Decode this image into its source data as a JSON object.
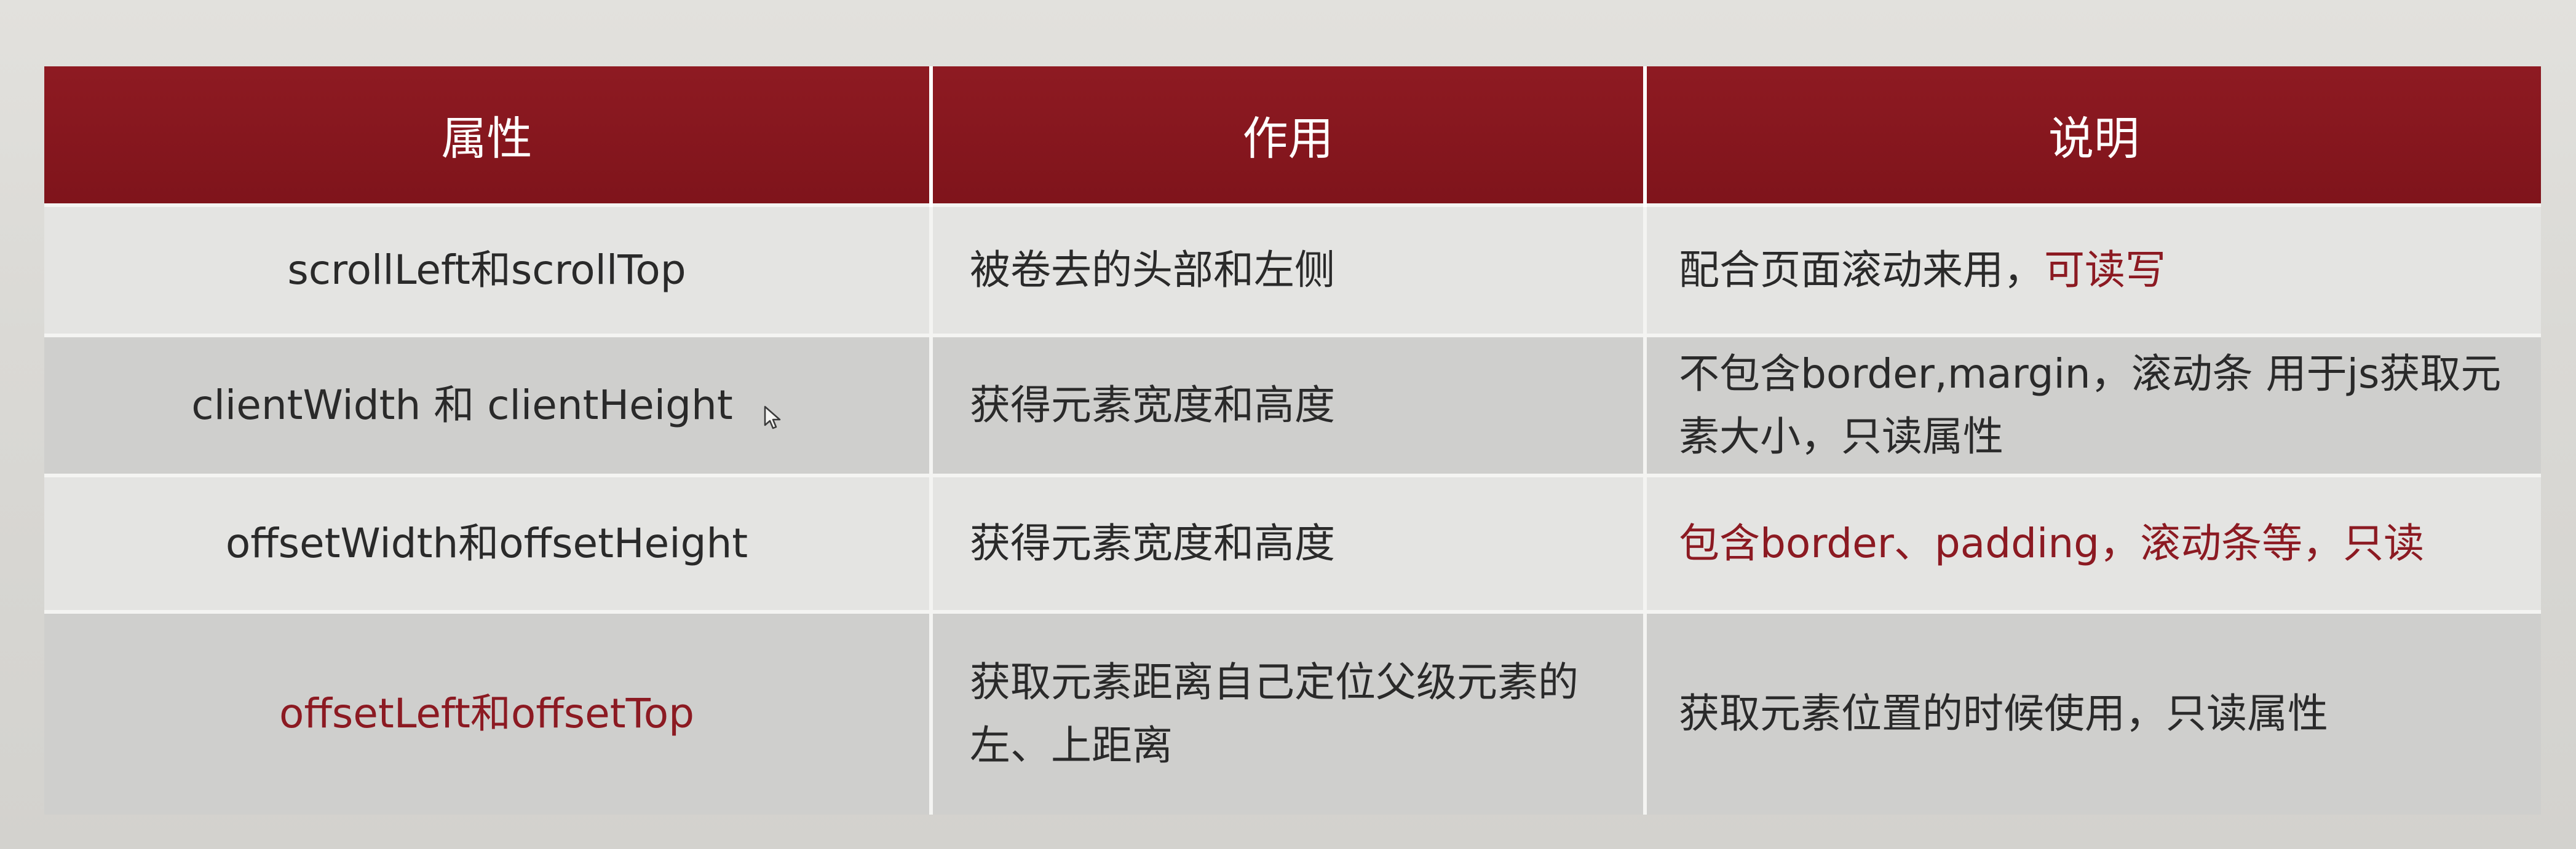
{
  "table": {
    "headers": [
      "属性",
      "作用",
      "说明"
    ],
    "rows": [
      {
        "property": "scrollLeft和scrollTop",
        "purpose": "被卷去的头部和左侧",
        "note_main": "配合页面滚动来用，",
        "note_highlight": "可读写"
      },
      {
        "property": "clientWidth 和 clientHeight",
        "purpose": "获得元素宽度和高度",
        "note": "不包含border,margin，滚动条 用于js获取元素大小，只读属性"
      },
      {
        "property": "offsetWidth和offsetHeight",
        "purpose": "获得元素宽度和高度",
        "note": "包含border、padding，滚动条等，只读"
      },
      {
        "property": "offsetLeft和offsetTop",
        "purpose": "获取元素距离自己定位父级元素的左、上距离",
        "note": "获取元素位置的时候使用，只读属性"
      }
    ]
  },
  "colors": {
    "header_bg": "#8e1a22",
    "highlight_text": "#8c1a22",
    "row_odd": "#e4e4e2",
    "row_even": "#cfcfcd"
  },
  "icons": {
    "cursor": "mouse-pointer-icon"
  }
}
